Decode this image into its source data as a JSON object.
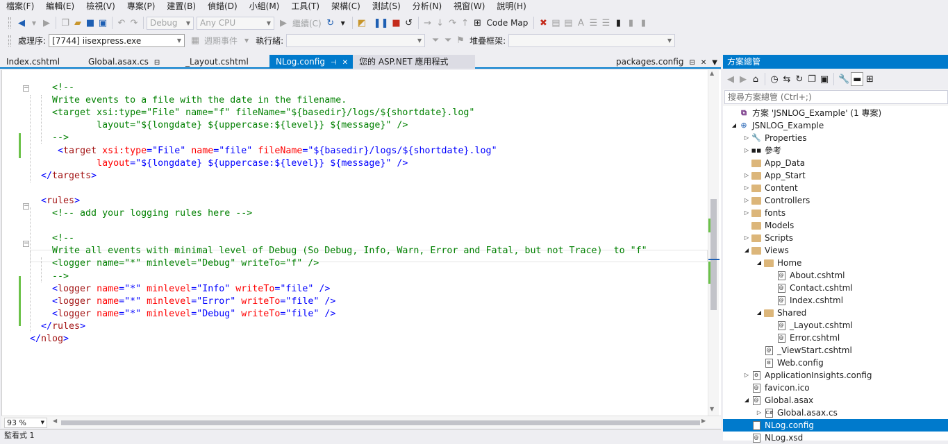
{
  "menu": [
    "檔案(F)",
    "編輯(E)",
    "檢視(V)",
    "專案(P)",
    "建置(B)",
    "偵錯(D)",
    "小組(M)",
    "工具(T)",
    "架構(C)",
    "測試(S)",
    "分析(N)",
    "視窗(W)",
    "說明(H)"
  ],
  "toolbar": {
    "config_value": "Debug",
    "platform_value": "Any CPU",
    "continue_label": "繼續(C)",
    "codemap_label": "Code Map"
  },
  "toolbar2": {
    "process_label": "處理序:",
    "process_value": "[7744] iisexpress.exe",
    "lifecycle_label": "週期事件",
    "thread_label": "執行緒:",
    "stackframe_label": "堆疊框架:"
  },
  "tabs": {
    "index": "Index.cshtml",
    "global": "Global.asax.cs",
    "layout": "_Layout.cshtml",
    "nlog": "NLog.config",
    "aspnet": "您的 ASP.NET 應用程式",
    "packages": "packages.config"
  },
  "code": [
    {
      "n": "l1",
      "parts": [
        [
          "c",
          "    <!--"
        ]
      ]
    },
    {
      "n": "l2",
      "parts": [
        [
          "c",
          "    Write events to a file with the date in the filename."
        ]
      ]
    },
    {
      "n": "l3",
      "parts": [
        [
          "c",
          "    <target xsi:type=\"File\" name=\"f\" fileName=\"${basedir}/logs/${shortdate}.log\""
        ]
      ]
    },
    {
      "n": "l4",
      "parts": [
        [
          "c",
          "            layout=\"${longdate} ${uppercase:${level}} ${message}\" />"
        ]
      ]
    },
    {
      "n": "l5",
      "parts": [
        [
          "c",
          "    -->"
        ]
      ]
    },
    {
      "n": "l6",
      "parts": [
        [
          "b",
          "     <"
        ],
        [
          "t",
          "target"
        ],
        [
          "a",
          " xsi:type"
        ],
        [
          "b",
          "=\""
        ],
        [
          "v",
          "File"
        ],
        [
          "b",
          "\""
        ],
        [
          "a",
          " name"
        ],
        [
          "b",
          "=\""
        ],
        [
          "v",
          "file"
        ],
        [
          "b",
          "\""
        ],
        [
          "a",
          " fileName"
        ],
        [
          "b",
          "=\""
        ],
        [
          "v",
          "${basedir}/logs/${shortdate}.log"
        ],
        [
          "b",
          "\""
        ]
      ]
    },
    {
      "n": "l7",
      "parts": [
        [
          "a",
          "            layout"
        ],
        [
          "b",
          "=\""
        ],
        [
          "v",
          "${longdate} ${uppercase:${level}} ${message}"
        ],
        [
          "b",
          "\" />"
        ]
      ]
    },
    {
      "n": "l8",
      "parts": [
        [
          "b",
          "  </"
        ],
        [
          "t",
          "targets"
        ],
        [
          "b",
          ">"
        ]
      ]
    },
    {
      "n": "l9",
      "parts": [
        [
          "b",
          ""
        ]
      ]
    },
    {
      "n": "l10",
      "parts": [
        [
          "b",
          "  <"
        ],
        [
          "t",
          "rules"
        ],
        [
          "b",
          ">"
        ]
      ]
    },
    {
      "n": "l11",
      "parts": [
        [
          "c",
          "    <!-- add your logging rules here -->"
        ]
      ]
    },
    {
      "n": "l12",
      "parts": [
        [
          "b",
          ""
        ]
      ]
    },
    {
      "n": "l13",
      "parts": [
        [
          "c",
          "    <!--"
        ]
      ]
    },
    {
      "n": "l14",
      "parts": [
        [
          "c",
          "    Write all events with minimal level of Debug (So Debug, Info, Warn, Error and Fatal, but not Trace)  to \"f\""
        ]
      ]
    },
    {
      "n": "l15",
      "parts": [
        [
          "c",
          "    <logger name=\"*\" minlevel=\"Debug\" writeTo=\"f\" />"
        ]
      ]
    },
    {
      "n": "l16",
      "parts": [
        [
          "c",
          "    -->"
        ]
      ]
    },
    {
      "n": "l17",
      "parts": [
        [
          "b",
          "    <"
        ],
        [
          "t",
          "logger"
        ],
        [
          "a",
          " name"
        ],
        [
          "b",
          "=\""
        ],
        [
          "v",
          "*"
        ],
        [
          "b",
          "\""
        ],
        [
          "a",
          " minlevel"
        ],
        [
          "b",
          "=\""
        ],
        [
          "v",
          "Info"
        ],
        [
          "b",
          "\""
        ],
        [
          "a",
          " writeTo"
        ],
        [
          "b",
          "=\""
        ],
        [
          "v",
          "file"
        ],
        [
          "b",
          "\" />"
        ]
      ]
    },
    {
      "n": "l18",
      "parts": [
        [
          "b",
          "    <"
        ],
        [
          "t",
          "logger"
        ],
        [
          "a",
          " name"
        ],
        [
          "b",
          "=\""
        ],
        [
          "v",
          "*"
        ],
        [
          "b",
          "\""
        ],
        [
          "a",
          " minlevel"
        ],
        [
          "b",
          "=\""
        ],
        [
          "v",
          "Error"
        ],
        [
          "b",
          "\""
        ],
        [
          "a",
          " writeTo"
        ],
        [
          "b",
          "=\""
        ],
        [
          "v",
          "file"
        ],
        [
          "b",
          "\" />"
        ]
      ]
    },
    {
      "n": "l19",
      "parts": [
        [
          "b",
          "    <"
        ],
        [
          "t",
          "logger"
        ],
        [
          "a",
          " name"
        ],
        [
          "b",
          "=\""
        ],
        [
          "v",
          "*"
        ],
        [
          "b",
          "\""
        ],
        [
          "a",
          " minlevel"
        ],
        [
          "b",
          "=\""
        ],
        [
          "v",
          "Debug"
        ],
        [
          "b",
          "\""
        ],
        [
          "a",
          " writeTo"
        ],
        [
          "b",
          "=\""
        ],
        [
          "v",
          "file"
        ],
        [
          "b",
          "\" />"
        ]
      ]
    },
    {
      "n": "l20",
      "parts": [
        [
          "b",
          "  </"
        ],
        [
          "t",
          "rules"
        ],
        [
          "b",
          ">"
        ]
      ]
    },
    {
      "n": "l21",
      "parts": [
        [
          "b",
          "</"
        ],
        [
          "t",
          "nlog"
        ],
        [
          "b",
          ">"
        ]
      ]
    }
  ],
  "zoom": "93 %",
  "bottom_panel": "監看式 1",
  "solution": {
    "title": "方案總管",
    "search_placeholder": "搜尋方案總管 (Ctrl+;)",
    "nodes": [
      {
        "label": "方案 'JSNLOG_Example' (1 專案)"
      },
      {
        "label": "JSNLOG_Example"
      },
      {
        "label": "Properties"
      },
      {
        "label": "參考"
      },
      {
        "label": "App_Data"
      },
      {
        "label": "App_Start"
      },
      {
        "label": "Content"
      },
      {
        "label": "Controllers"
      },
      {
        "label": "fonts"
      },
      {
        "label": "Models"
      },
      {
        "label": "Scripts"
      },
      {
        "label": "Views"
      },
      {
        "label": "Home"
      },
      {
        "label": "About.cshtml"
      },
      {
        "label": "Contact.cshtml"
      },
      {
        "label": "Index.cshtml"
      },
      {
        "label": "Shared"
      },
      {
        "label": "_Layout.cshtml"
      },
      {
        "label": "Error.cshtml"
      },
      {
        "label": "_ViewStart.cshtml"
      },
      {
        "label": "Web.config"
      },
      {
        "label": "ApplicationInsights.config"
      },
      {
        "label": "favicon.ico"
      },
      {
        "label": "Global.asax"
      },
      {
        "label": "Global.asax.cs"
      },
      {
        "label": "NLog.config"
      },
      {
        "label": "NLog.xsd"
      }
    ]
  }
}
